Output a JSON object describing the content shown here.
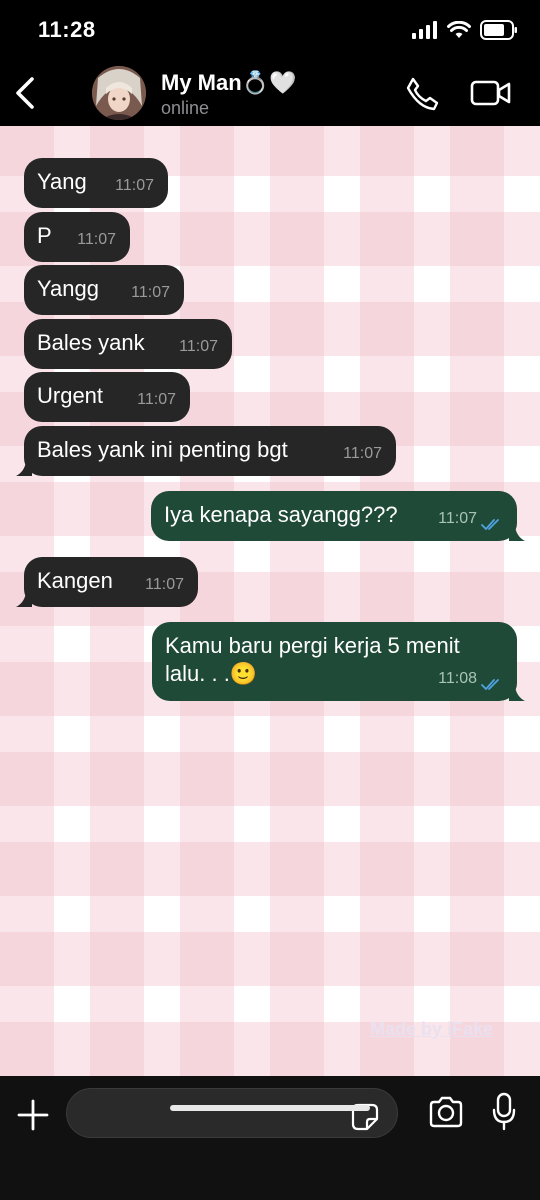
{
  "status_bar": {
    "time": "11:28"
  },
  "contact": {
    "name": "My Man💍🤍",
    "status": "online"
  },
  "messages": [
    {
      "dir": "in",
      "text": "Yang",
      "time": "11:07"
    },
    {
      "dir": "in",
      "text": "P",
      "time": "11:07"
    },
    {
      "dir": "in",
      "text": "Yangg",
      "time": "11:07"
    },
    {
      "dir": "in",
      "text": "Bales yank",
      "time": "11:07"
    },
    {
      "dir": "in",
      "text": "Urgent",
      "time": "11:07"
    },
    {
      "dir": "in",
      "text": "Bales yank ini penting bgt",
      "time": "11:07"
    },
    {
      "dir": "out",
      "text": "Iya kenapa sayangg???",
      "time": "11:07"
    },
    {
      "dir": "in",
      "text": "Kangen",
      "time": "11:07"
    },
    {
      "dir": "out",
      "text_line1": "Kamu baru pergi kerja 5 menit",
      "text_line2": "lalu. . .🙂",
      "time": "11:08"
    }
  ],
  "watermark": "Made by iFake",
  "input": {
    "placeholder": ""
  },
  "colors": {
    "incoming_bubble": "#262626",
    "outgoing_bubble": "#1f4a37",
    "read_ticks": "#4fa3e0"
  }
}
